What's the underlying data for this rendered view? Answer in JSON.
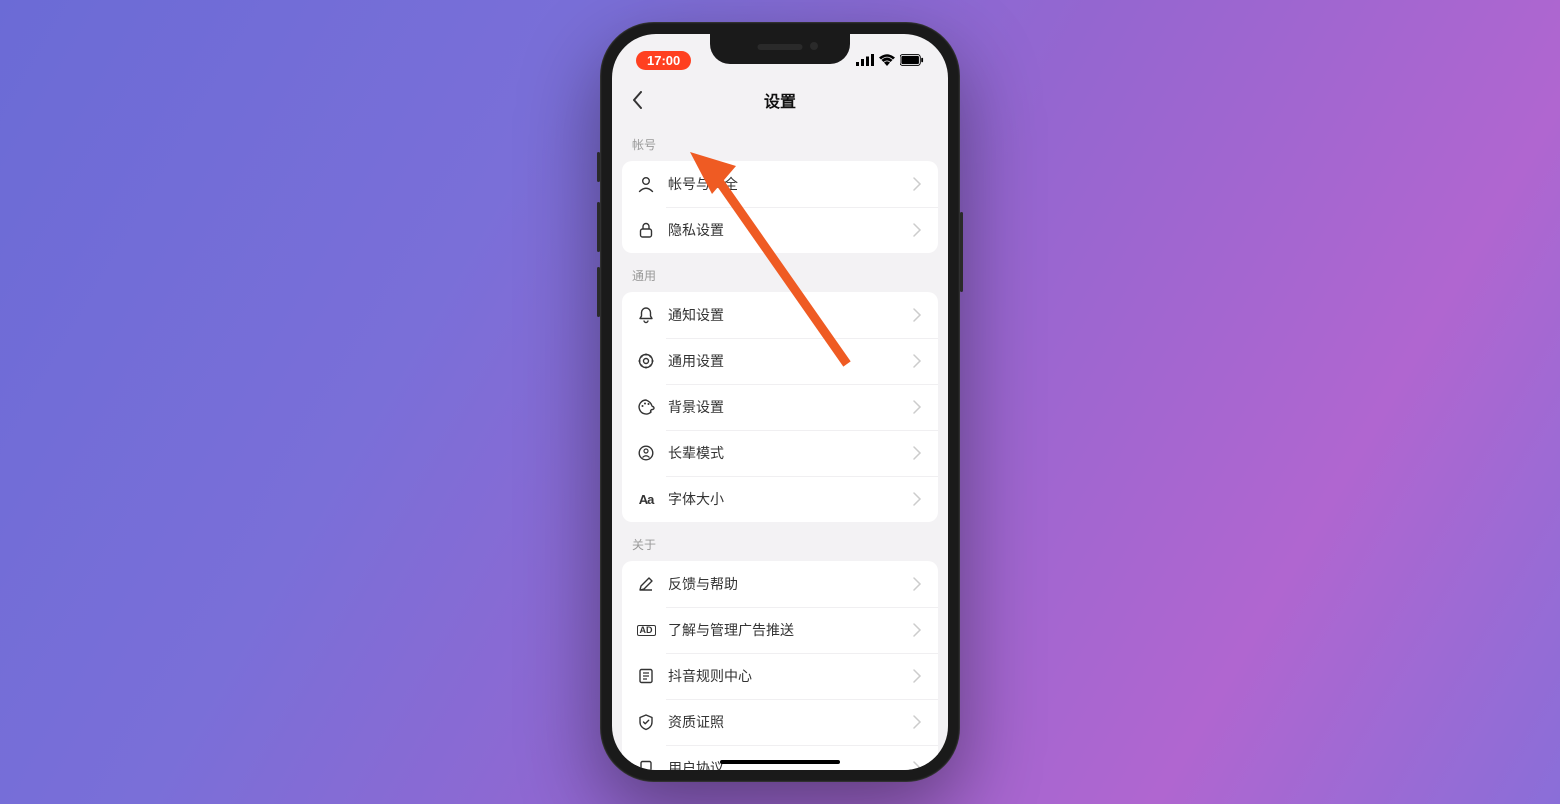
{
  "status": {
    "time": "17:00"
  },
  "nav": {
    "title": "设置"
  },
  "sections": [
    {
      "header": "帐号",
      "items": [
        {
          "icon": "user",
          "label": "帐号与安全"
        },
        {
          "icon": "lock",
          "label": "隐私设置"
        }
      ]
    },
    {
      "header": "通用",
      "items": [
        {
          "icon": "bell",
          "label": "通知设置"
        },
        {
          "icon": "gear",
          "label": "通用设置"
        },
        {
          "icon": "palette",
          "label": "背景设置"
        },
        {
          "icon": "elder",
          "label": "长辈模式"
        },
        {
          "icon": "aa",
          "label": "字体大小"
        }
      ]
    },
    {
      "header": "关于",
      "items": [
        {
          "icon": "pencil",
          "label": "反馈与帮助"
        },
        {
          "icon": "ad",
          "label": "了解与管理广告推送"
        },
        {
          "icon": "rules",
          "label": "抖音规则中心"
        },
        {
          "icon": "shield",
          "label": "资质证照"
        },
        {
          "icon": "doc",
          "label": "用户协议"
        }
      ]
    }
  ]
}
